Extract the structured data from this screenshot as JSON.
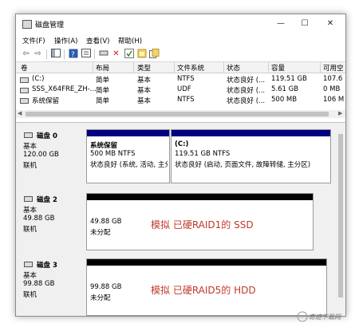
{
  "window": {
    "title": "磁盘管理",
    "controls": [
      "—",
      "☐",
      "✕"
    ]
  },
  "menu": [
    "文件(F)",
    "操作(A)",
    "查看(V)",
    "帮助(H)"
  ],
  "toolbar_icons": [
    "back-arrow-icon",
    "forward-arrow-icon",
    "console-tree-icon",
    "help-icon",
    "properties-icon",
    "connect-icon",
    "delete-icon",
    "check-icon",
    "new-volume-icon",
    "refresh-icon"
  ],
  "volumes": {
    "columns": [
      "卷",
      "布局",
      "类型",
      "文件系统",
      "状态",
      "容量",
      "可用空"
    ],
    "rows": [
      [
        "(C:)",
        "简单",
        "基本",
        "NTFS",
        "状态良好 (...",
        "119.51 GB",
        "107.6"
      ],
      [
        "SSS_X64FRE_ZH-...",
        "简单",
        "基本",
        "UDF",
        "状态良好 (...",
        "5.61 GB",
        "0 MB"
      ],
      [
        "系统保留",
        "简单",
        "基本",
        "NTFS",
        "状态良好 (...",
        "500 MB",
        "106 M"
      ]
    ]
  },
  "disks": [
    {
      "name": "磁盘 0",
      "type": "基本",
      "size": "120.00 GB",
      "status": "联机",
      "partitions": [
        {
          "label": "系统保留",
          "detail": "500 MB NTFS",
          "state": "状态良好 (系统, 活动, 主分"
        },
        {
          "label": "(C:)",
          "detail": "119.51 GB NTFS",
          "state": "状态良好 (启动, 页面文件, 故障转储, 主分区)"
        }
      ]
    },
    {
      "name": "磁盘 2",
      "type": "基本",
      "size": "49.88 GB",
      "status": "联机",
      "partitions": [
        {
          "size": "49.88 GB",
          "state": "未分配",
          "note": "模拟 已硬RAID1的 SSD"
        }
      ]
    },
    {
      "name": "磁盘 3",
      "type": "基本",
      "size": "99.88 GB",
      "status": "联机",
      "partitions": [
        {
          "size": "99.88 GB",
          "state": "未分配",
          "note": "模拟 已硬RAID5的 HDD"
        }
      ]
    }
  ],
  "colors": {
    "primary_partition": "#000080",
    "unallocated": "#000000",
    "note": "#c0392b"
  },
  "watermark": "奇迹下载网"
}
